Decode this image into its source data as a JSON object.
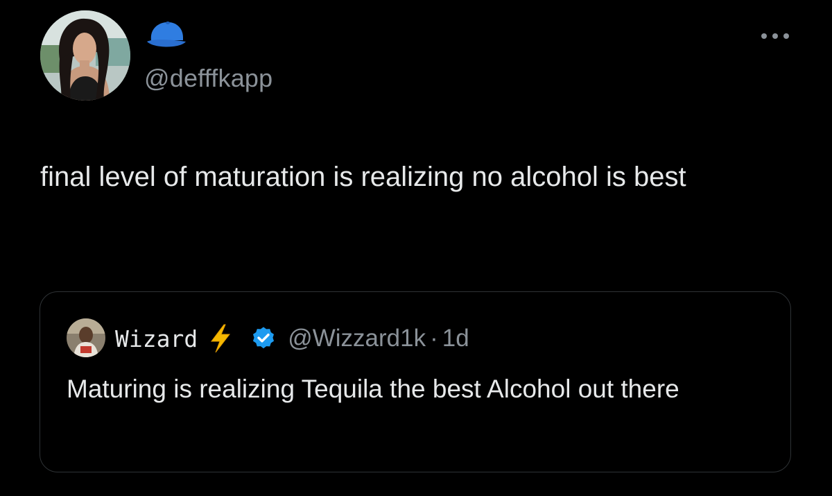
{
  "tweet": {
    "author_handle": "@defffkapp",
    "author_badge_icon": "blue-cap-icon",
    "menu_icon": "more-horizontal-icon",
    "text": "final level of maturation is realizing no alcohol is best"
  },
  "quoted_tweet": {
    "author_name": "Wizard",
    "name_badge_icon": "lightning-bolt-icon",
    "verified_icon": "verified-badge-icon",
    "author_handle": "@Wizzard1k",
    "separator": "·",
    "time": "1d",
    "text": "Maturing is realizing Tequila the best Alcohol out there"
  },
  "colors": {
    "background": "#000000",
    "primary_text": "#e7e9ea",
    "secondary_text": "#8b9299",
    "card_border": "#2f3336",
    "verified_blue": "#1d9bf0",
    "cap_blue": "#2f7de1",
    "bolt_yellow": "#f5b800"
  }
}
